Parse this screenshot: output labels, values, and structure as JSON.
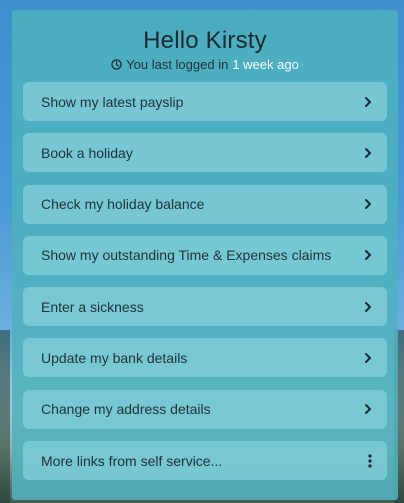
{
  "header": {
    "greeting": "Hello Kirsty",
    "last_login_prefix": "You last logged in",
    "last_login_value": "1 week ago"
  },
  "menu": {
    "items": [
      {
        "label": "Show my latest payslip",
        "icon": "chevron-right-icon"
      },
      {
        "label": "Book a holiday",
        "icon": "chevron-right-icon"
      },
      {
        "label": "Check my holiday balance",
        "icon": "chevron-right-icon"
      },
      {
        "label": "Show my outstanding Time & Expenses claims",
        "icon": "chevron-right-icon"
      },
      {
        "label": "Enter a sickness",
        "icon": "chevron-right-icon"
      },
      {
        "label": "Update my bank details",
        "icon": "chevron-right-icon"
      },
      {
        "label": "Change my address details",
        "icon": "chevron-right-icon"
      },
      {
        "label": "More links from self service...",
        "icon": "more-vertical-icon"
      }
    ]
  },
  "colors": {
    "panel": "#4eb0be",
    "item": "#82ced8",
    "text": "#22333a",
    "accent_text": "#ffffff"
  }
}
